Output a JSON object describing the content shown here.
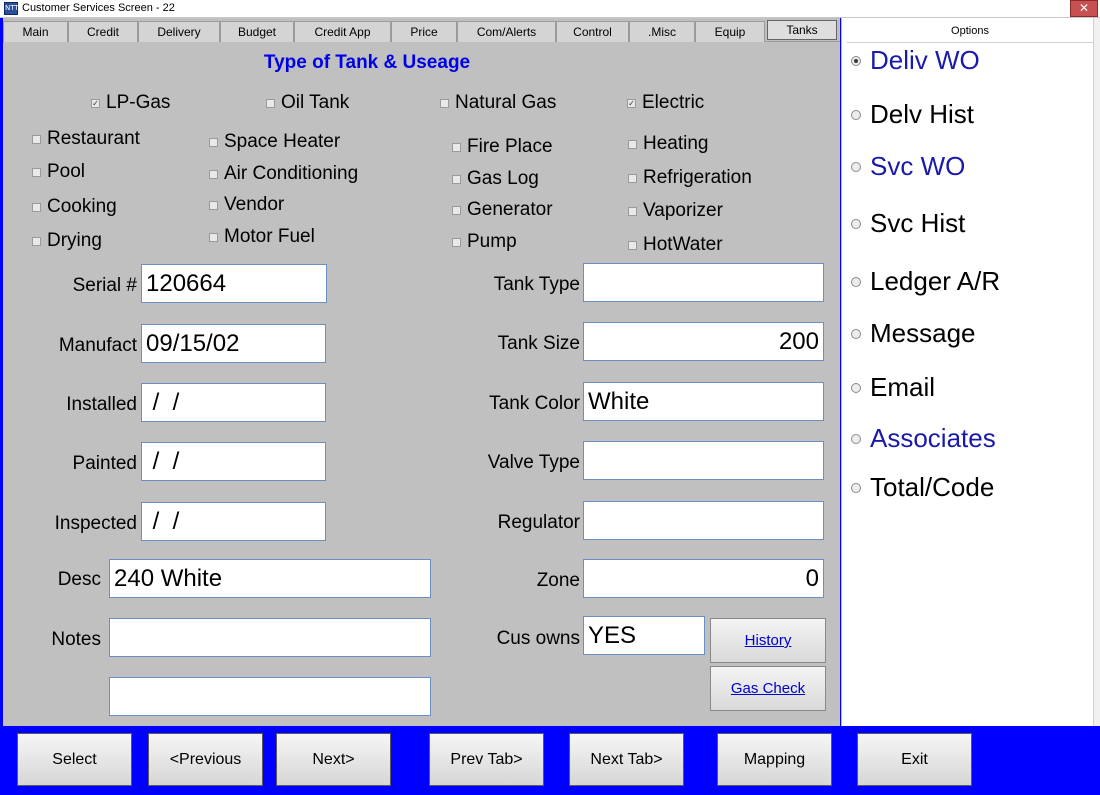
{
  "window": {
    "title": "Customer Services Screen - 22",
    "icon_text": "NTT",
    "close_glyph": "✕"
  },
  "tabs": [
    {
      "label": "Main"
    },
    {
      "label": "Credit"
    },
    {
      "label": "Delivery"
    },
    {
      "label": "Budget"
    },
    {
      "label": "Credit App"
    },
    {
      "label": "Price"
    },
    {
      "label": "Com/Alerts"
    },
    {
      "label": "Control"
    },
    {
      "label": ".Misc"
    },
    {
      "label": "Equip"
    },
    {
      "label": "Tanks",
      "active": true
    }
  ],
  "section_title": "Type of Tank & Useage",
  "fuel_types": [
    {
      "label": "LP-Gas",
      "checked": true
    },
    {
      "label": "Oil Tank",
      "checked": false
    },
    {
      "label": "Natural Gas",
      "checked": false
    },
    {
      "label": "Electric",
      "checked": true
    }
  ],
  "usage": [
    {
      "label": "Restaurant"
    },
    {
      "label": "Pool"
    },
    {
      "label": "Cooking"
    },
    {
      "label": "Drying"
    },
    {
      "label": "Space Heater"
    },
    {
      "label": "Air Conditioning"
    },
    {
      "label": "Vendor"
    },
    {
      "label": "Motor Fuel"
    },
    {
      "label": "Fire Place"
    },
    {
      "label": "Gas Log"
    },
    {
      "label": "Generator"
    },
    {
      "label": "Pump"
    },
    {
      "label": "Heating"
    },
    {
      "label": "Refrigeration"
    },
    {
      "label": "Vaporizer"
    },
    {
      "label": "HotWater"
    }
  ],
  "fields": {
    "serial": {
      "label": "Serial #",
      "value": "120664"
    },
    "manufact": {
      "label": "Manufact",
      "value": "09/15/02"
    },
    "installed": {
      "label": "Installed",
      "value": " /  /"
    },
    "painted": {
      "label": "Painted",
      "value": " /  /"
    },
    "inspected": {
      "label": "Inspected",
      "value": " /  /"
    },
    "desc": {
      "label": "Desc",
      "value": "240 White"
    },
    "notes": {
      "label": "Notes",
      "value": "",
      "value2": ""
    },
    "tank_type": {
      "label": "Tank Type",
      "value": ""
    },
    "tank_size": {
      "label": "Tank Size",
      "value": "200"
    },
    "tank_color": {
      "label": "Tank Color",
      "value": "White"
    },
    "valve_type": {
      "label": "Valve Type",
      "value": ""
    },
    "regulator": {
      "label": "Regulator",
      "value": ""
    },
    "zone": {
      "label": "Zone",
      "value": "0"
    },
    "cus_owns": {
      "label": "Cus owns",
      "value": "YES"
    }
  },
  "side_buttons": {
    "history": "History",
    "gas_check": "Gas Check"
  },
  "options": {
    "header": "Options",
    "items": [
      {
        "label": "Deliv WO",
        "style": "link",
        "selected": true
      },
      {
        "label": "Delv Hist",
        "style": "plain"
      },
      {
        "label": "Svc WO",
        "style": "link"
      },
      {
        "label": "Svc Hist",
        "style": "plain"
      },
      {
        "label": "Ledger A/R",
        "style": "plain"
      },
      {
        "label": "Message",
        "style": "plain"
      },
      {
        "label": "Email",
        "style": "plain"
      },
      {
        "label": "Associates",
        "style": "link"
      },
      {
        "label": "Total/Code",
        "style": "plain"
      }
    ]
  },
  "bottom_buttons": {
    "select": "Select",
    "previous": "<Previous",
    "next": "Next>",
    "prev_tab": "Prev Tab>",
    "next_tab": "Next Tab>",
    "mapping": "Mapping",
    "exit": "Exit"
  },
  "colors": {
    "accent_blue": "#0000e6",
    "footer_blue": "#0000ff",
    "panel_gray": "#c0c0c0"
  }
}
